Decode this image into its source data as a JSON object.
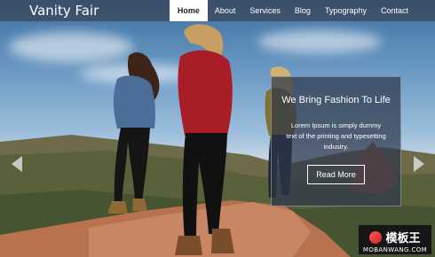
{
  "brand": "Vanity Fair",
  "nav_items": [
    "Home",
    "About",
    "Services",
    "Blog",
    "Typography",
    "Contact"
  ],
  "active_nav": "Home",
  "hero": {
    "title": "We Bring Fashion To Life",
    "text": "Lorem Ipsum is simply dummy text of the printing and typesetting industry.",
    "button": "Read More"
  },
  "watermark": {
    "main": "模板王",
    "sub": "MOBANWANG.COM"
  },
  "colors": {
    "nav_bg": "#373C4B",
    "panel_bg": "#2D374B",
    "active_bg": "#FFFFFF"
  }
}
